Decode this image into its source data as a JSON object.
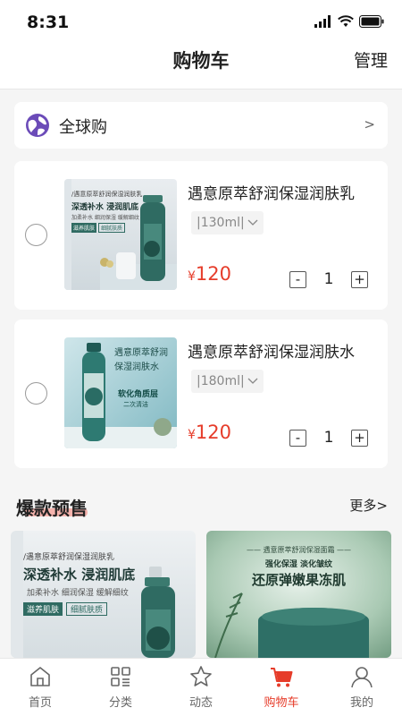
{
  "status_bar": {
    "time": "8:31",
    "icons": [
      "signal-icon",
      "wifi-icon",
      "battery-icon"
    ]
  },
  "nav": {
    "title": "购物车",
    "manage_label": "管理"
  },
  "global_shopping": {
    "label": "全球购",
    "arrow": ">",
    "icon": "globe-icon"
  },
  "cart_items": [
    {
      "name": "遇意原萃舒润保湿润肤乳",
      "spec": "|130ml|",
      "currency": "¥",
      "price": "120",
      "quantity": "1",
      "minus": "-",
      "plus": "+",
      "image": {
        "top_text": "/遇意原萃舒润保湿润肤乳",
        "headline": "深透补水 浸润肌底",
        "sub": "加柔补水 细润保湿 缓解细纹",
        "tags": [
          "滋养肌肤",
          "细腻肤质"
        ]
      }
    },
    {
      "name": "遇意原萃舒润保湿润肤水",
      "spec": "|180ml|",
      "currency": "¥",
      "price": "120",
      "quantity": "1",
      "minus": "-",
      "plus": "+",
      "image": {
        "top_text": "遇意原萃舒润",
        "headline": "保湿润肤水",
        "sub": "软化角质层",
        "tags": [
          "二次清洁"
        ]
      }
    }
  ],
  "presale": {
    "title": "爆款预售",
    "more_label": "更多>",
    "items": [
      {
        "top_text": "/遇意原萃舒润保湿润肤乳",
        "headline": "深透补水 浸润肌底",
        "sub": "加柔补水 细润保湿 缓解细纹",
        "tags": [
          "滋养肌肤",
          "细腻肤质"
        ]
      },
      {
        "top_text": "—— 遇意原萃舒润保湿面霜 ——",
        "headline": "还原弹嫩果冻肌",
        "sub": "强化保湿 淡化皱纹",
        "tags": []
      }
    ]
  },
  "tab_bar": {
    "items": [
      {
        "label": "首页",
        "icon": "home-icon"
      },
      {
        "label": "分类",
        "icon": "category-icon"
      },
      {
        "label": "动态",
        "icon": "star-icon"
      },
      {
        "label": "购物车",
        "icon": "cart-icon"
      },
      {
        "label": "我的",
        "icon": "profile-icon"
      }
    ],
    "active_index": 3
  },
  "colors": {
    "accent": "#e63c2a",
    "background": "#f5f5f5",
    "card": "#ffffff"
  }
}
